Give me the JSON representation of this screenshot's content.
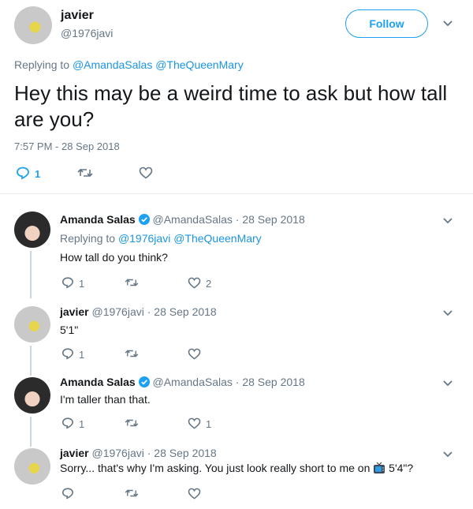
{
  "main_tweet": {
    "display_name": "javier",
    "handle": "@1976javi",
    "follow_label": "Follow",
    "replying_prefix": "Replying to",
    "replying_to": [
      "@AmandaSalas",
      "@TheQueenMary"
    ],
    "text": "Hey this may be a weird time to ask but how tall are you?",
    "timestamp": "7:57 PM - 28 Sep 2018",
    "actions": {
      "reply_count": "1",
      "retweet_count": "",
      "like_count": ""
    }
  },
  "replies": [
    {
      "display_name": "Amanda Salas",
      "verified": true,
      "handle": "@AmandaSalas",
      "date": "· 28 Sep 2018",
      "replying_prefix": "Replying to",
      "replying_to": [
        "@1976javi",
        "@TheQueenMary"
      ],
      "text": "How tall do you think?",
      "reply_count": "1",
      "like_count": "2"
    },
    {
      "display_name": "javier",
      "verified": false,
      "handle": "@1976javi",
      "date": "· 28 Sep 2018",
      "text": "5'1\"",
      "reply_count": "1",
      "like_count": ""
    },
    {
      "display_name": "Amanda Salas",
      "verified": true,
      "handle": "@AmandaSalas",
      "date": "· 28 Sep 2018",
      "text": "I'm taller than that.",
      "reply_count": "1",
      "like_count": "1"
    },
    {
      "display_name": "javier",
      "verified": false,
      "handle": "@1976javi",
      "date": "· 28 Sep 2018",
      "text_before": "Sorry... that's why I'm asking. You just look really short to me on",
      "tv_emoji": "tv-icon",
      "text_after": "5'4\"?",
      "reply_count": "",
      "like_count": ""
    }
  ],
  "colors": {
    "accent": "#1da1f2",
    "link": "#1b95e0",
    "muted": "#657786",
    "verified": "#1da1f2"
  }
}
